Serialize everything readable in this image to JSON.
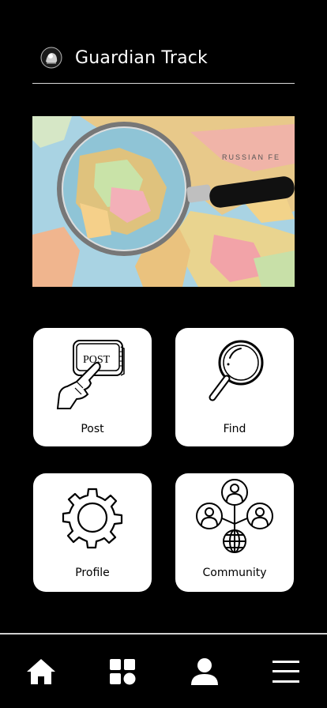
{
  "header": {
    "app_title": "Guardian Track",
    "logo_icon": "app-logo-icon"
  },
  "hero": {
    "image": "world-map-with-magnifying-glass"
  },
  "cards": {
    "post": {
      "label": "Post",
      "icon": "post-button-press-icon",
      "art_text": "POST"
    },
    "find": {
      "label": "Find",
      "icon": "magnifying-glass-icon"
    },
    "profile": {
      "label": "Profile",
      "icon": "gear-icon"
    },
    "community": {
      "label": "Community",
      "icon": "network-people-icon"
    }
  },
  "bottom_nav": [
    {
      "name": "home",
      "icon": "home-icon"
    },
    {
      "name": "apps",
      "icon": "grid-icon"
    },
    {
      "name": "account",
      "icon": "user-icon"
    },
    {
      "name": "menu",
      "icon": "hamburger-menu-icon"
    }
  ],
  "colors": {
    "background": "#000000",
    "card": "#ffffff",
    "text": "#ffffff",
    "card_text": "#000000"
  }
}
